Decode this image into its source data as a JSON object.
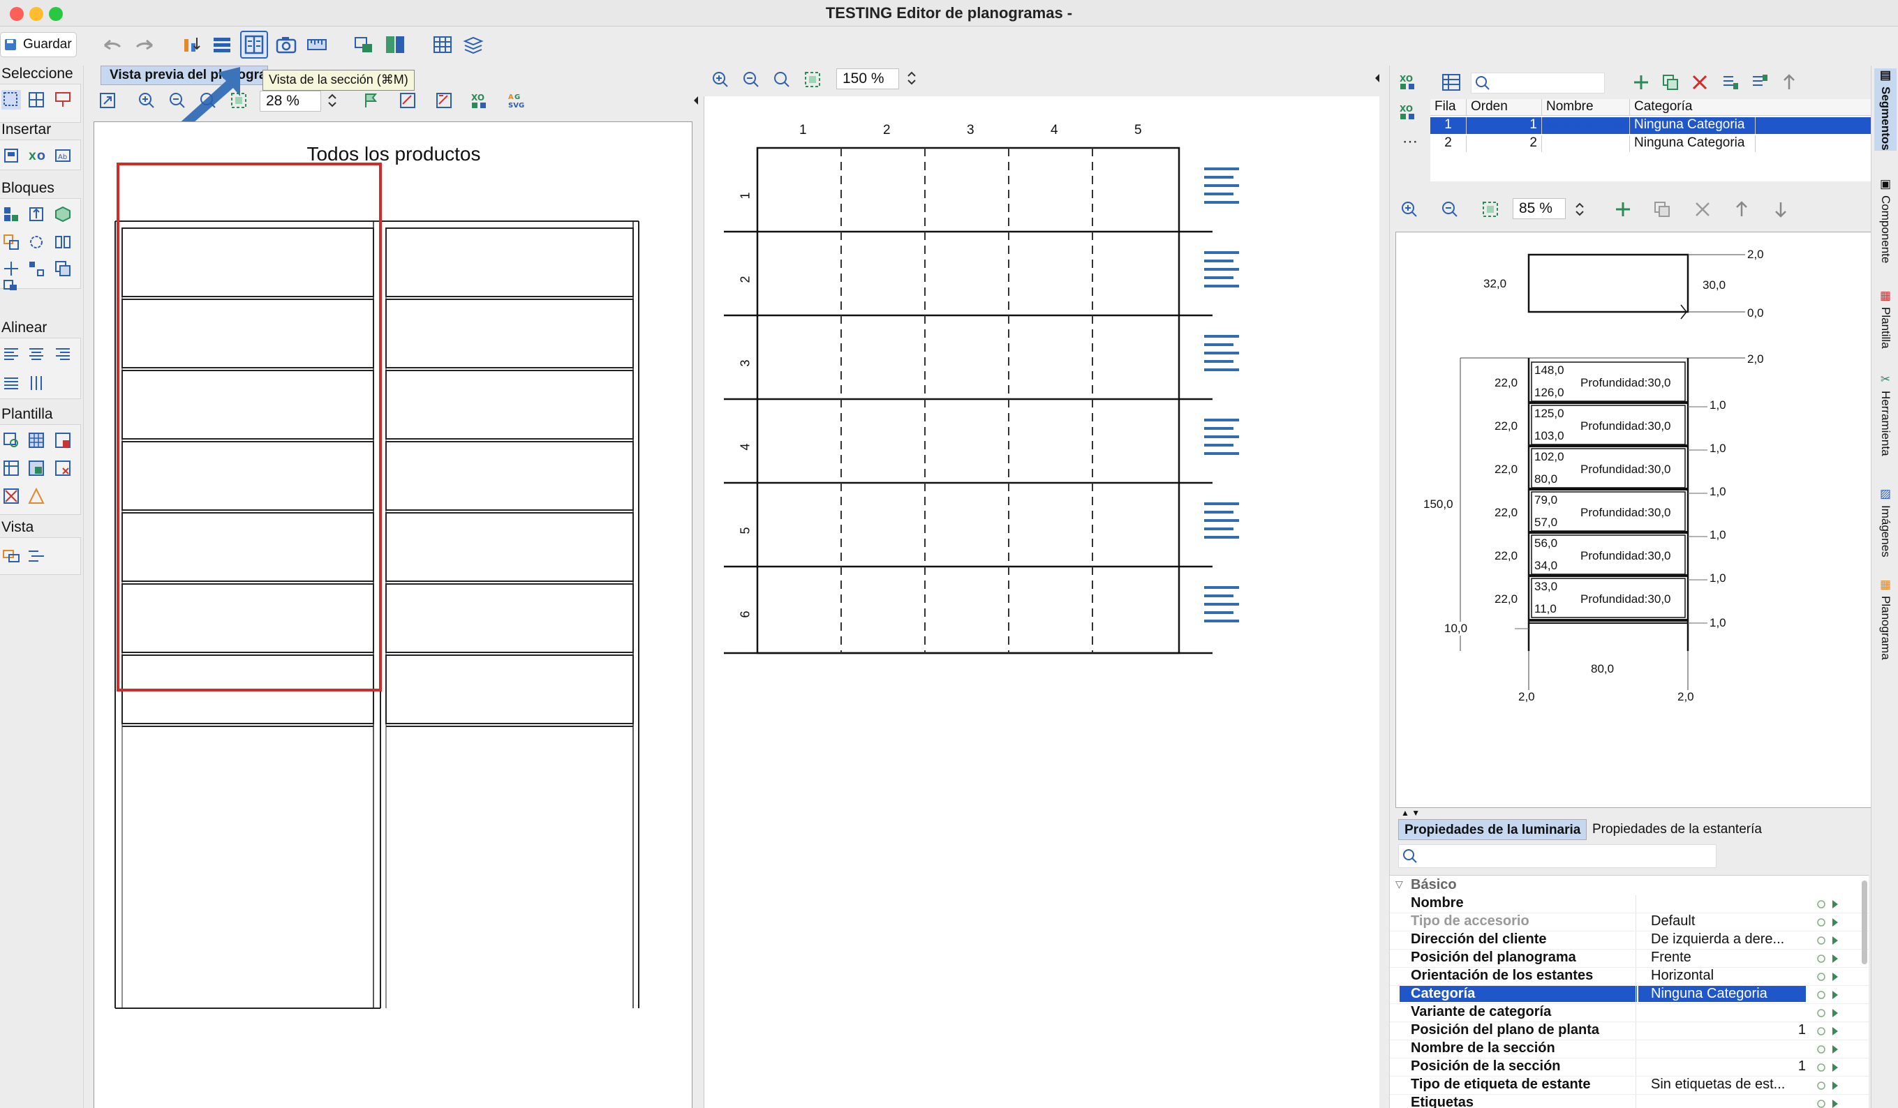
{
  "window": {
    "title": "TESTING Editor de planogramas -"
  },
  "toolbar": {
    "save_label": "Guardar",
    "tooltip": "Vista de la sección  (⌘M)"
  },
  "palette": {
    "sections": [
      "Seleccione",
      "Insertar",
      "Bloques",
      "Alinear",
      "Plantilla",
      "Vista"
    ]
  },
  "preview": {
    "tab_label": "Vista previa del planograma",
    "zoom": "28 %",
    "title": "Todos los productos"
  },
  "section": {
    "zoom": "150 %",
    "columns": [
      "1",
      "2",
      "3",
      "4",
      "5"
    ],
    "rows": [
      "1",
      "2",
      "3",
      "4",
      "5",
      "6"
    ]
  },
  "segments": {
    "headers": [
      "Fila",
      "Orden",
      "Nombre",
      "Categoría"
    ],
    "rows": [
      {
        "fila": "1",
        "orden": "1",
        "nombre": "Ninguna Categoria",
        "categoria": "Ninguna Categoria"
      },
      {
        "fila": "2",
        "orden": "2",
        "nombre": "Ninguna Categoria",
        "categoria": "Ninguna Categoria"
      }
    ]
  },
  "dims": {
    "zoom": "85 %",
    "top_labels": {
      "top_right": "2,0",
      "left_depth": "32,0",
      "right_depth": "30,0",
      "bottom_right": "0,0",
      "shelf_top": "2,0"
    },
    "height_total": "150,0",
    "base_left": "10,0",
    "width": "80,0",
    "foot_left": "2,0",
    "foot_right": "2,0",
    "shelves": [
      {
        "left": "22,0",
        "top": "148,0",
        "bottom": "126,0",
        "depth": "Profundidad:30,0",
        "right": "1,0"
      },
      {
        "left": "22,0",
        "top": "125,0",
        "bottom": "103,0",
        "depth": "Profundidad:30,0",
        "right": "1,0"
      },
      {
        "left": "22,0",
        "top": "102,0",
        "bottom": "80,0",
        "depth": "Profundidad:30,0",
        "right": "1,0"
      },
      {
        "left": "22,0",
        "top": "79,0",
        "bottom": "57,0",
        "depth": "Profundidad:30,0",
        "right": "1,0"
      },
      {
        "left": "22,0",
        "top": "56,0",
        "bottom": "34,0",
        "depth": "Profundidad:30,0",
        "right": "1,0"
      },
      {
        "left": "22,0",
        "top": "33,0",
        "bottom": "11,0",
        "depth": "Profundidad:30,0",
        "right": "1,0"
      }
    ]
  },
  "properties": {
    "tabs": [
      "Propiedades de la luminaria",
      "Propiedades de la estantería"
    ],
    "group": "Básico",
    "rows": [
      {
        "name": "Nombre",
        "value": "",
        "num": ""
      },
      {
        "name": "Tipo de accesorio",
        "value": "Default",
        "num": ""
      },
      {
        "name": "Dirección del cliente",
        "value": "De izquierda a dere...",
        "num": ""
      },
      {
        "name": "Posición del planograma",
        "value": "Frente",
        "num": ""
      },
      {
        "name": "Orientación de los estantes",
        "value": "Horizontal",
        "num": ""
      },
      {
        "name": "Categoría",
        "value": "Ninguna Categoria",
        "num": ""
      },
      {
        "name": "Variante de categoría",
        "value": "",
        "num": ""
      },
      {
        "name": "Posición del plano de planta",
        "value": "",
        "num": "1"
      },
      {
        "name": "Nombre de la sección",
        "value": "",
        "num": ""
      },
      {
        "name": "Posición de la sección",
        "value": "",
        "num": "1"
      },
      {
        "name": "Tipo de etiqueta de estante",
        "value": "Sin etiquetas de est...",
        "num": ""
      },
      {
        "name": "Etiquetas",
        "value": "",
        "num": ""
      }
    ]
  },
  "sidetabs": [
    "Segmentos",
    "Componente",
    "Plantilla",
    "Herramienta",
    "Imágenes",
    "Planograma"
  ],
  "colors": {
    "selection": "#1f56c9",
    "accent": "#2a62c6",
    "red": "#d42a2a"
  }
}
